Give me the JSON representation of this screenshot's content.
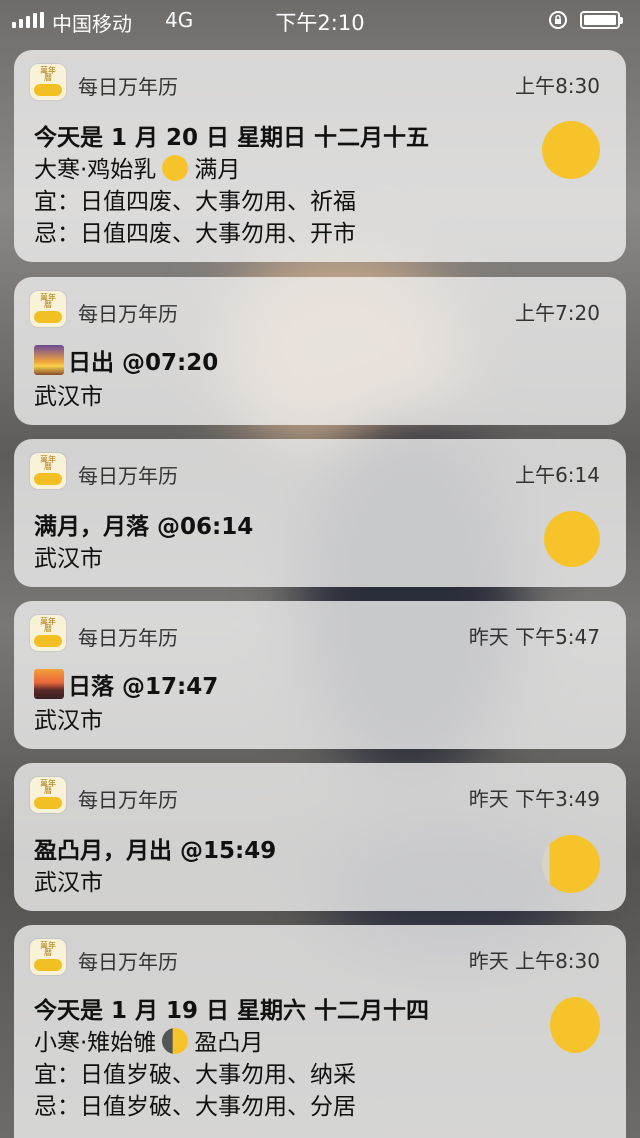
{
  "status_bar": {
    "carrier": "中国移动",
    "network": "4G",
    "time": "下午2:10",
    "battery_icon": "battery-full-icon",
    "rotation_lock_icon": "rotation-lock-icon"
  },
  "colors": {
    "card_bg": "#f0f0f0",
    "moon": "#f6c42a",
    "text": "#111111"
  },
  "notifications": [
    {
      "app": "每日万年历",
      "time": "上午8:30",
      "title": "今天是 1 月 20 日 星期日 十二月十五",
      "line2_a": "大寒·鸡始乳",
      "line2_b": "满月",
      "line3": "宜：日值四废、大事勿用、祈福",
      "line4": "忌：日值四废、大事勿用、开市",
      "icon": "full-moon-icon"
    },
    {
      "app": "每日万年历",
      "time": "上午7:20",
      "title": "日出 @07:20",
      "location": "武汉市",
      "icon": "sunrise-icon"
    },
    {
      "app": "每日万年历",
      "time": "上午6:14",
      "title": "满月，月落 @06:14",
      "location": "武汉市",
      "icon": "full-moon-icon"
    },
    {
      "app": "每日万年历",
      "time": "昨天 下午5:47",
      "title": "日落 @17:47",
      "location": "武汉市",
      "icon": "sunset-icon"
    },
    {
      "app": "每日万年历",
      "time": "昨天 下午3:49",
      "title": "盈凸月，月出 @15:49",
      "location": "武汉市",
      "icon": "waxing-gibbous-moon-icon"
    },
    {
      "app": "每日万年历",
      "time": "昨天 上午8:30",
      "title": "今天是 1 月 19 日 星期六 十二月十四",
      "line2_a": "小寒·雉始雊",
      "line2_b": "盈凸月",
      "line3": "宜：日值岁破、大事勿用、纳采",
      "line4": "忌：日值岁破、大事勿用、分居",
      "icon": "waxing-gibbous-moon-icon"
    }
  ],
  "app_icon_text": "萬年曆"
}
